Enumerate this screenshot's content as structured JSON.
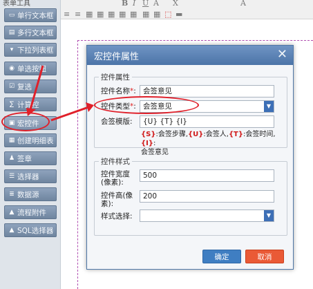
{
  "toolbox": {
    "title": "表单工具",
    "buttons": [
      {
        "label": "单行文本框",
        "icon": "textbox-icon"
      },
      {
        "label": "多行文本框",
        "icon": "textarea-icon"
      },
      {
        "label": "下拉列表框",
        "icon": "dropdown-icon"
      },
      {
        "label": "单选按钮",
        "icon": "radio-icon"
      },
      {
        "label": "复选",
        "icon": "checkbox-icon"
      },
      {
        "label": "计算控",
        "icon": "calculator-icon"
      },
      {
        "label": "宏控件",
        "icon": "macro-icon"
      },
      {
        "label": "创建明细表",
        "icon": "table-icon"
      },
      {
        "label": "签章",
        "icon": "stamp-icon"
      },
      {
        "label": "选择器",
        "icon": "selector-icon"
      },
      {
        "label": "数据源",
        "icon": "database-icon"
      },
      {
        "label": "流程附件",
        "icon": "attachment-icon"
      },
      {
        "label": "SQL选择器",
        "icon": "sql-icon"
      }
    ]
  },
  "toolbar": {
    "icons": [
      "B",
      "I",
      "U",
      "A",
      "X",
      "A"
    ]
  },
  "dialog": {
    "title": "宏控件属性",
    "attr_group": "控件属性",
    "name_label": "控件名称",
    "name_value": "会签意见",
    "type_label": "控件类型",
    "type_value": "会签意见",
    "template_label": "会签模版:",
    "template_value": "{U} {T} {I}",
    "hint": {
      "s_code": "{S}",
      "s_text": ":会签步骤,",
      "u_code": "{U}",
      "u_text": ":会签人,",
      "t_code": "{T}",
      "t_text": ":会签时间,",
      "i_code": "{I}",
      "i_text": ":",
      "line2": "会签意见"
    },
    "style_group": "控件样式",
    "width_label": "控件宽度(像素):",
    "width_value": "500",
    "height_label": "控件高(像素):",
    "height_value": "200",
    "style_label": "样式选择:",
    "style_value": "",
    "ok_label": "确定",
    "cancel_label": "取消",
    "required_mark": "*",
    "colon": ":"
  },
  "colors": {
    "header": "#4c74a8",
    "ok": "#3f7ec2",
    "cancel": "#ea5a36",
    "annotation": "#e0202a"
  }
}
